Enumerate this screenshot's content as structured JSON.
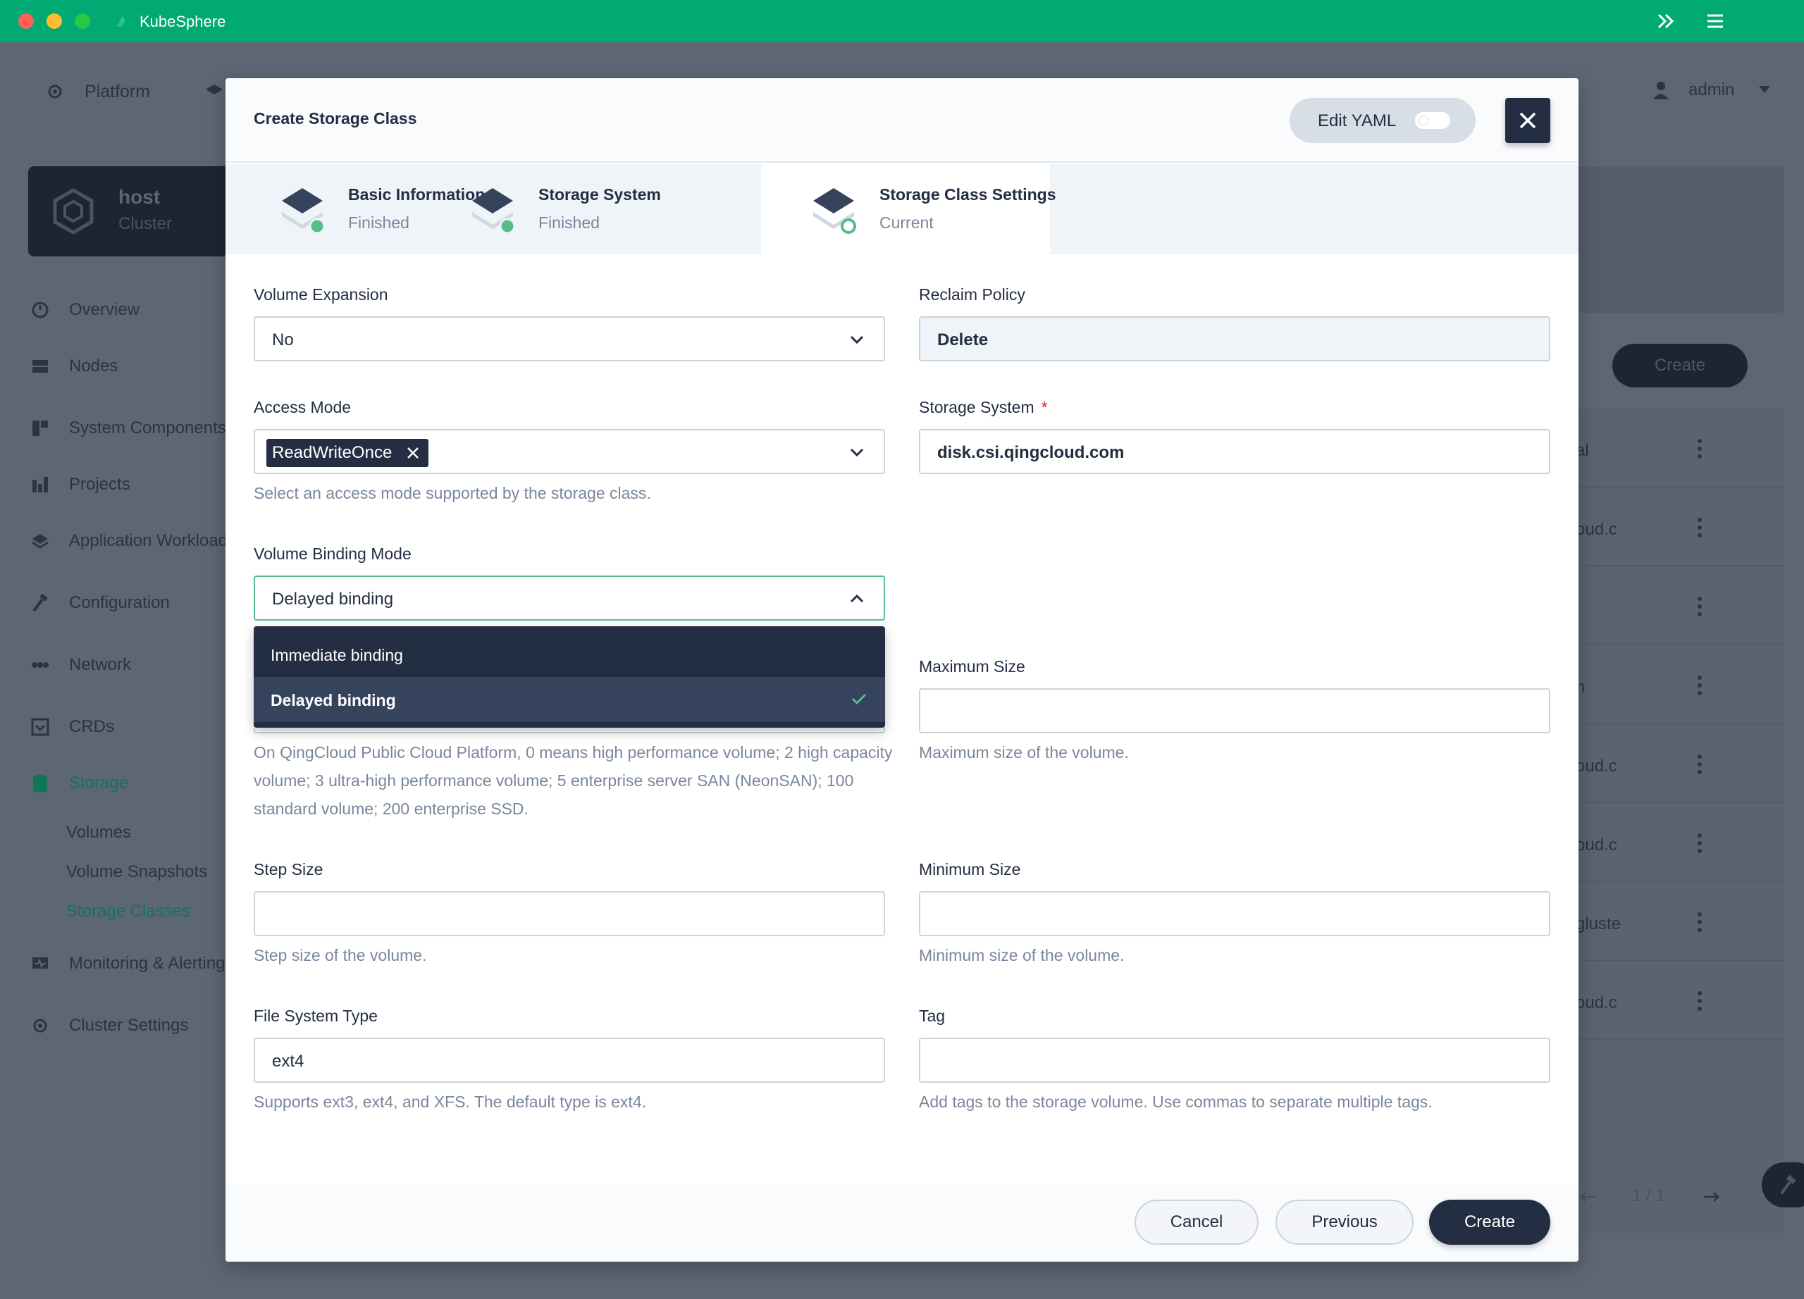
{
  "window": {
    "app_title": "KubeSphere"
  },
  "background": {
    "platform_label": "Platform",
    "user_name": "admin",
    "cluster": {
      "name": "host",
      "subtitle": "Cluster"
    },
    "nav": [
      {
        "label": "Overview",
        "icon": "dashboard-icon"
      },
      {
        "label": "Nodes",
        "icon": "nodes-icon"
      },
      {
        "label": "System Components",
        "icon": "components-icon"
      },
      {
        "label": "Projects",
        "icon": "projects-icon"
      },
      {
        "label": "Application Workloads",
        "icon": "workloads-icon"
      },
      {
        "label": "Configuration",
        "icon": "hammer-icon"
      },
      {
        "label": "Network",
        "icon": "network-icon"
      },
      {
        "label": "CRDs",
        "icon": "crd-icon"
      },
      {
        "label": "Storage",
        "icon": "database-icon"
      },
      {
        "label": "Monitoring & Alerting",
        "icon": "monitor-icon"
      },
      {
        "label": "Cluster Settings",
        "icon": "gear-icon"
      }
    ],
    "storage_sub": [
      "Volumes",
      "Volume Snapshots",
      "Storage Classes"
    ],
    "create_label": "Create",
    "table_fragments": [
      "al",
      "oud.c",
      "",
      "n",
      "oud.c",
      "oud.c",
      "gluste",
      "oud.c"
    ],
    "pager": "1 / 1"
  },
  "modal": {
    "title": "Create Storage Class",
    "edit_yaml_label": "Edit YAML",
    "steps": [
      {
        "title": "Basic Information",
        "status": "Finished"
      },
      {
        "title": "Storage System",
        "status": "Finished"
      },
      {
        "title": "Storage Class Settings",
        "status": "Current"
      }
    ],
    "form": {
      "volume_expansion": {
        "label": "Volume Expansion",
        "value": "No"
      },
      "reclaim_policy": {
        "label": "Reclaim Policy",
        "value": "Delete"
      },
      "access_mode": {
        "label": "Access Mode",
        "tag": "ReadWriteOnce",
        "help": "Select an access mode supported by the storage class."
      },
      "storage_system": {
        "label": "Storage System",
        "required_mark": "*",
        "value": "disk.csi.qingcloud.com"
      },
      "volume_binding_mode": {
        "label": "Volume Binding Mode",
        "value": "Delayed binding",
        "options": [
          "Immediate binding",
          "Delayed binding"
        ],
        "type_help": "On QingCloud Public Cloud Platform, 0 means high performance volume; 2 high capacity volume; 3 ultra-high performance volume; 5 enterprise server SAN (NeonSAN); 100 standard volume; 200 enterprise SSD."
      },
      "maximum_size": {
        "label": "Maximum Size",
        "value": "",
        "help": "Maximum size of the volume."
      },
      "step_size": {
        "label": "Step Size",
        "value": "",
        "help": "Step size of the volume."
      },
      "minimum_size": {
        "label": "Minimum Size",
        "value": "",
        "help": "Minimum size of the volume."
      },
      "file_system_type": {
        "label": "File System Type",
        "value": "ext4",
        "help": "Supports ext3, ext4, and XFS. The default type is ext4."
      },
      "tag": {
        "label": "Tag",
        "value": "",
        "help": "Add tags to the storage volume. Use commas to separate multiple tags."
      }
    },
    "footer": {
      "cancel": "Cancel",
      "previous": "Previous",
      "create": "Create"
    }
  },
  "colors": {
    "titlebar": "#00aa72",
    "primary_dark": "#242e42",
    "success": "#55bc8a",
    "overlay": "#5d6674"
  }
}
